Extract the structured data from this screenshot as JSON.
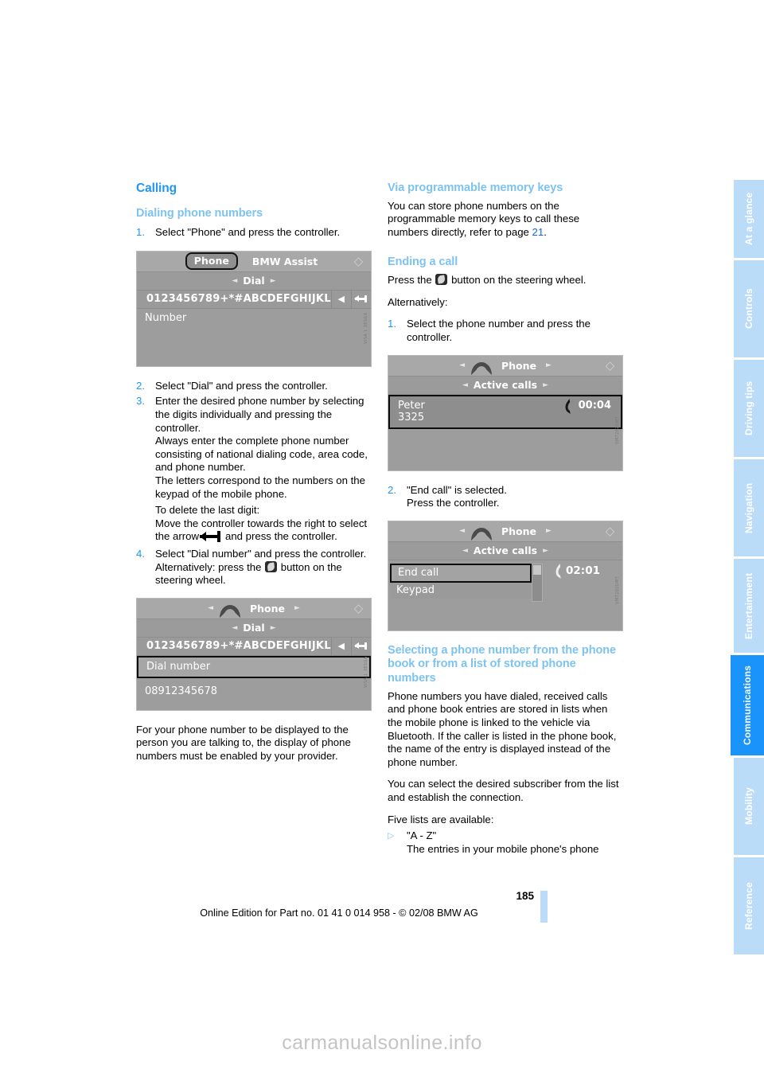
{
  "document": {
    "page_number": "185",
    "footer_text": "Online Edition for Part no. 01 41 0 014 958 - © 02/08 BMW AG",
    "watermark": "carmanualsonline.info"
  },
  "sidenav": {
    "items": [
      {
        "label": "At a glance",
        "active": false
      },
      {
        "label": "Controls",
        "active": false
      },
      {
        "label": "Driving tips",
        "active": false
      },
      {
        "label": "Navigation",
        "active": false
      },
      {
        "label": "Entertainment",
        "active": false
      },
      {
        "label": "Communications",
        "active": true
      },
      {
        "label": "Mobility",
        "active": false
      },
      {
        "label": "Reference",
        "active": false
      }
    ]
  },
  "left_column": {
    "section_title": "Calling",
    "sub_title": "Dialing phone numbers",
    "step1": {
      "marker": "1.",
      "text": "Select \"Phone\" and press the controller."
    },
    "screenshot1": {
      "tab_selected": "Phone",
      "tab_other": "BMW Assist",
      "sub_row": "Dial",
      "keypad_chars": "0123456789+*#ABCDEFGHIJKL",
      "list_label": "Number",
      "side_code": "VISA 1 3ESGA"
    },
    "step2": {
      "marker": "2.",
      "text": "Select \"Dial\" and press the controller."
    },
    "step3": {
      "marker": "3.",
      "line1": "Enter the desired phone number by selecting the digits individually and pressing the controller.",
      "line2": "Always enter the complete phone number consisting of national dialing code, area code, and phone number.",
      "line3": "The letters correspond to the numbers on the keypad of the mobile phone.",
      "line4": "To delete the last digit:",
      "line5_a": "Move the controller towards the right to select the arrow",
      "line5_b": "and press the controller."
    },
    "step4": {
      "marker": "4.",
      "line1": "Select \"Dial number\" and press the controller.",
      "line2_a": "Alternatively: press the",
      "line2_b": "button on the steering wheel."
    },
    "screenshot2": {
      "header_title": "Phone",
      "sub_row": "Dial",
      "keypad_chars": "0123456789+*#ABCDEFGHIJKL",
      "row_selected": "Dial number",
      "row_value": "08912345678",
      "side_code": "VISA 1 3ESGA"
    },
    "closing_paragraph": "For your phone number to be displayed to the person you are talking to, the display of phone numbers must be enabled by your provider."
  },
  "right_column": {
    "memory_keys": {
      "title": "Via programmable memory keys",
      "text_a": "You can store phone numbers on the programmable memory keys to call these numbers directly, refer to page",
      "page_ref": "21",
      "text_b": "."
    },
    "ending_call": {
      "title": "Ending a call",
      "press_a": "Press the",
      "press_b": "button on the steering wheel.",
      "alternatively": "Alternatively:",
      "step1": {
        "marker": "1.",
        "text": "Select the phone number and press the controller."
      },
      "step2": {
        "marker": "2.",
        "line1": "\"End call\" is selected.",
        "line2": "Press the controller."
      }
    },
    "screenshot3": {
      "header_title": "Phone",
      "sub_row": "Active calls",
      "row_name": "Peter",
      "row_number": "3325",
      "timer": "00:04",
      "side_code": "VM7202DMT"
    },
    "screenshot4": {
      "header_title": "Phone",
      "sub_row": "Active calls",
      "row_selected": "End call",
      "row_second": "Keypad",
      "timer": "02:01",
      "side_code": "VM7202DMT"
    },
    "phone_book": {
      "title": "Selecting a phone number from the phone book or from a list of stored phone numbers",
      "para1": "Phone numbers you have dialed, received calls and phone book entries are stored in lists when the mobile phone is linked to the vehicle via Bluetooth. If the caller is listed in the phone book, the name of the entry is displayed instead of the phone number.",
      "para2": "You can select the desired subscriber from the list and establish the connection.",
      "para3": "Five lists are available:",
      "bullet1": {
        "marker": "▷",
        "title": "\"A - Z\"",
        "text": "The entries in your mobile phone's phone"
      }
    }
  }
}
